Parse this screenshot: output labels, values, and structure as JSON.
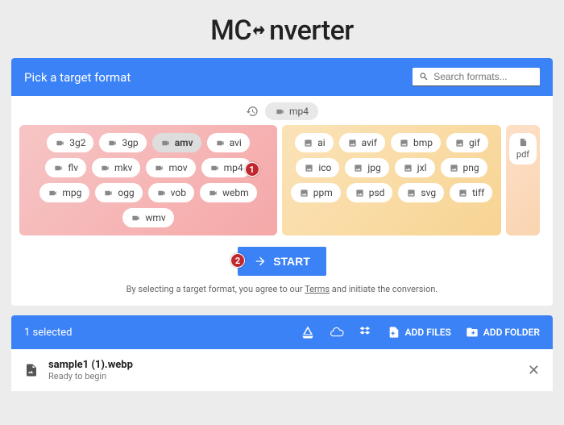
{
  "logo": {
    "left": "MC",
    "right": "nverter"
  },
  "header": {
    "title": "Pick a target format",
    "search_placeholder": "Search formats..."
  },
  "recent": {
    "label": "mp4"
  },
  "groups": {
    "video": [
      "3g2",
      "3gp",
      "amv",
      "avi",
      "flv",
      "mkv",
      "mov",
      "mp4",
      "mpg",
      "ogg",
      "vob",
      "webm",
      "wmv"
    ],
    "image": [
      "ai",
      "avif",
      "bmp",
      "gif",
      "ico",
      "jpg",
      "jxl",
      "png",
      "ppm",
      "psd",
      "svg",
      "tiff"
    ],
    "doc": [
      "pdf"
    ]
  },
  "selected_format": "amv",
  "badges": {
    "mp4": "1",
    "start": "2"
  },
  "start": {
    "label": "START"
  },
  "disclaimer": {
    "pre": "By selecting a target format, you agree to our ",
    "terms": "Terms",
    "post": " and initiate the conversion."
  },
  "toolbar": {
    "selected": "1 selected",
    "add_files": "ADD FILES",
    "add_folder": "ADD FOLDER"
  },
  "file": {
    "name": "sample1 (1).webp",
    "status": "Ready to begin"
  }
}
